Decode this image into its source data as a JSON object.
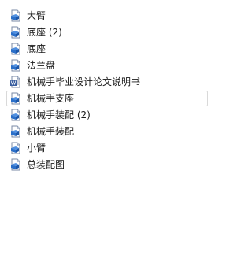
{
  "files": [
    {
      "name": "大臂",
      "icon": "solidworks-part-icon"
    },
    {
      "name": "底座 (2)",
      "icon": "solidworks-part-icon"
    },
    {
      "name": "底座",
      "icon": "solidworks-part-icon"
    },
    {
      "name": "法兰盘",
      "icon": "solidworks-part-icon"
    },
    {
      "name": "机械手毕业设计论文说明书",
      "icon": "word-document-icon"
    },
    {
      "name": "机械手支座",
      "icon": "solidworks-part-icon",
      "selected": true
    },
    {
      "name": "机械手装配 (2)",
      "icon": "solidworks-part-icon"
    },
    {
      "name": "机械手装配",
      "icon": "solidworks-part-icon"
    },
    {
      "name": "小臂",
      "icon": "solidworks-part-icon"
    },
    {
      "name": "总装配图",
      "icon": "solidworks-part-icon"
    }
  ],
  "colors": {
    "icon_blue": "#2a6fc9",
    "selection_border": "#d9d9d9"
  }
}
